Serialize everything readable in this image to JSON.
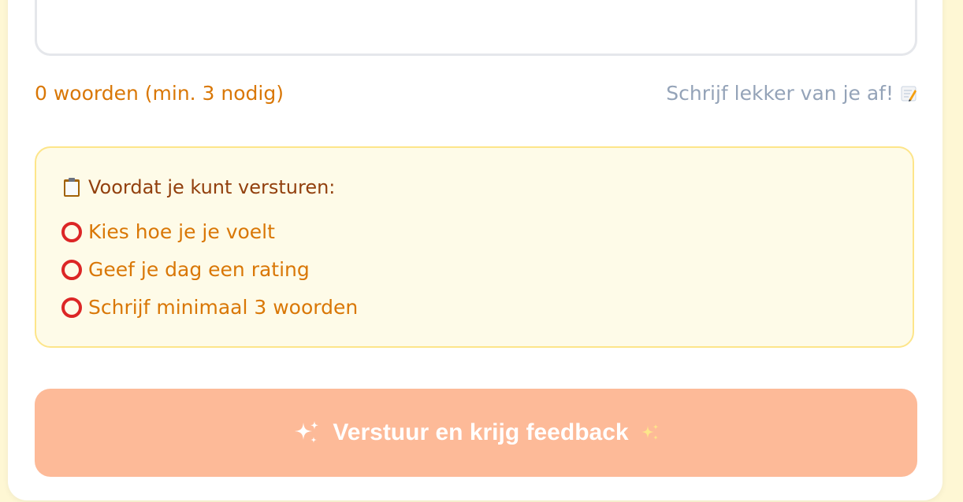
{
  "editor": {
    "word_count_label": "0 woorden (min. 3 nodig)",
    "hint_label": "Schrijf lekker van je af!",
    "hint_icon": "memo-icon"
  },
  "checklist": {
    "title": "Voordat je kunt versturen:",
    "title_icon": "clipboard-icon",
    "items": [
      {
        "label": "Kies hoe je je voelt",
        "status_icon": "hollow-red-circle-icon"
      },
      {
        "label": "Geef je dag een rating",
        "status_icon": "hollow-red-circle-icon"
      },
      {
        "label": "Schrijf minimaal 3 woorden",
        "status_icon": "hollow-red-circle-icon"
      }
    ]
  },
  "submit": {
    "label": "Verstuur en krijg feedback",
    "leading_icon": "sparkles-icon",
    "trailing_icon": "sparkles-icon"
  },
  "colors": {
    "page_background": "#fef7d4",
    "warning_text": "#d97706",
    "checklist_background": "#fefbe8",
    "checklist_border": "#fde58a",
    "submit_disabled": "#fdba98",
    "ring": "#dc2626"
  }
}
